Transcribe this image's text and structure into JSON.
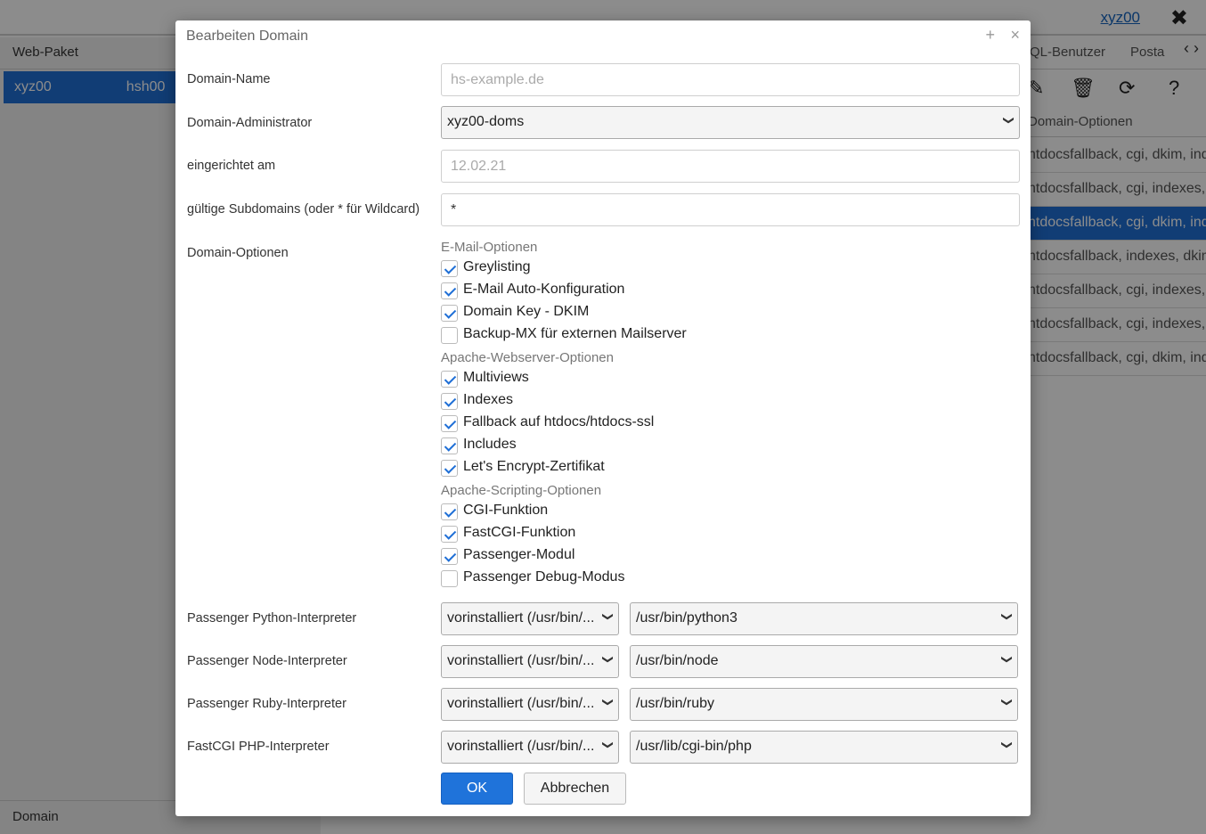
{
  "background": {
    "user_link": "xyz00",
    "logout_icon": "close-icon",
    "left_panel": {
      "header": "Web-Paket",
      "selected_row": [
        "xyz00",
        "hsh00"
      ],
      "footer": "Domain"
    },
    "right_panel": {
      "tabs": [
        "QL-Benutzer",
        "Posta"
      ],
      "column_header": "Domain-Optionen",
      "rows": [
        "htdocsfallback, cgi, dkim, ind",
        "htdocsfallback, cgi, indexes,",
        "htdocsfallback, cgi, dkim, ind",
        "htdocsfallback, indexes, dkim",
        "htdocsfallback, cgi, indexes,",
        "htdocsfallback, cgi, indexes,",
        "htdocsfallback, cgi, dkim, ind"
      ],
      "selected_row_index": 2
    }
  },
  "dialog": {
    "title": "Bearbeiten Domain",
    "domain_name": {
      "label": "Domain-Name",
      "placeholder": "hs-example.de"
    },
    "domain_admin": {
      "label": "Domain-Administrator",
      "value": "xyz00-doms"
    },
    "created": {
      "label": "eingerichtet am",
      "placeholder": "12.02.21"
    },
    "subdomains": {
      "label": "gültige Subdomains (oder * für Wildcard)",
      "value": "*"
    },
    "options": {
      "label": "Domain-Optionen",
      "groups": [
        {
          "title": "E-Mail-Optionen",
          "items": [
            {
              "label": "Greylisting",
              "checked": true
            },
            {
              "label": "E-Mail Auto-Konfiguration",
              "checked": true
            },
            {
              "label": "Domain Key - DKIM",
              "checked": true
            },
            {
              "label": "Backup-MX für externen Mailserver",
              "checked": false
            }
          ]
        },
        {
          "title": "Apache-Webserver-Optionen",
          "items": [
            {
              "label": "Multiviews",
              "checked": true
            },
            {
              "label": "Indexes",
              "checked": true
            },
            {
              "label": "Fallback auf htdocs/htdocs-ssl",
              "checked": true
            },
            {
              "label": "Includes",
              "checked": true
            },
            {
              "label": "Let's Encrypt-Zertifikat",
              "checked": true
            }
          ]
        },
        {
          "title": "Apache-Scripting-Optionen",
          "items": [
            {
              "label": "CGI-Funktion",
              "checked": true
            },
            {
              "label": "FastCGI-Funktion",
              "checked": true
            },
            {
              "label": "Passenger-Modul",
              "checked": true
            },
            {
              "label": "Passenger Debug-Modus",
              "checked": false
            }
          ]
        }
      ]
    },
    "interpreters": [
      {
        "label": "Passenger Python-Interpreter",
        "mode": "vorinstalliert (/usr/bin/...",
        "path": "/usr/bin/python3"
      },
      {
        "label": "Passenger Node-Interpreter",
        "mode": "vorinstalliert (/usr/bin/...",
        "path": "/usr/bin/node"
      },
      {
        "label": "Passenger Ruby-Interpreter",
        "mode": "vorinstalliert (/usr/bin/...",
        "path": "/usr/bin/ruby"
      },
      {
        "label": "FastCGI PHP-Interpreter",
        "mode": "vorinstalliert (/usr/bin/...",
        "path": "/usr/lib/cgi-bin/php"
      }
    ],
    "ok_label": "OK",
    "cancel_label": "Abbrechen"
  }
}
